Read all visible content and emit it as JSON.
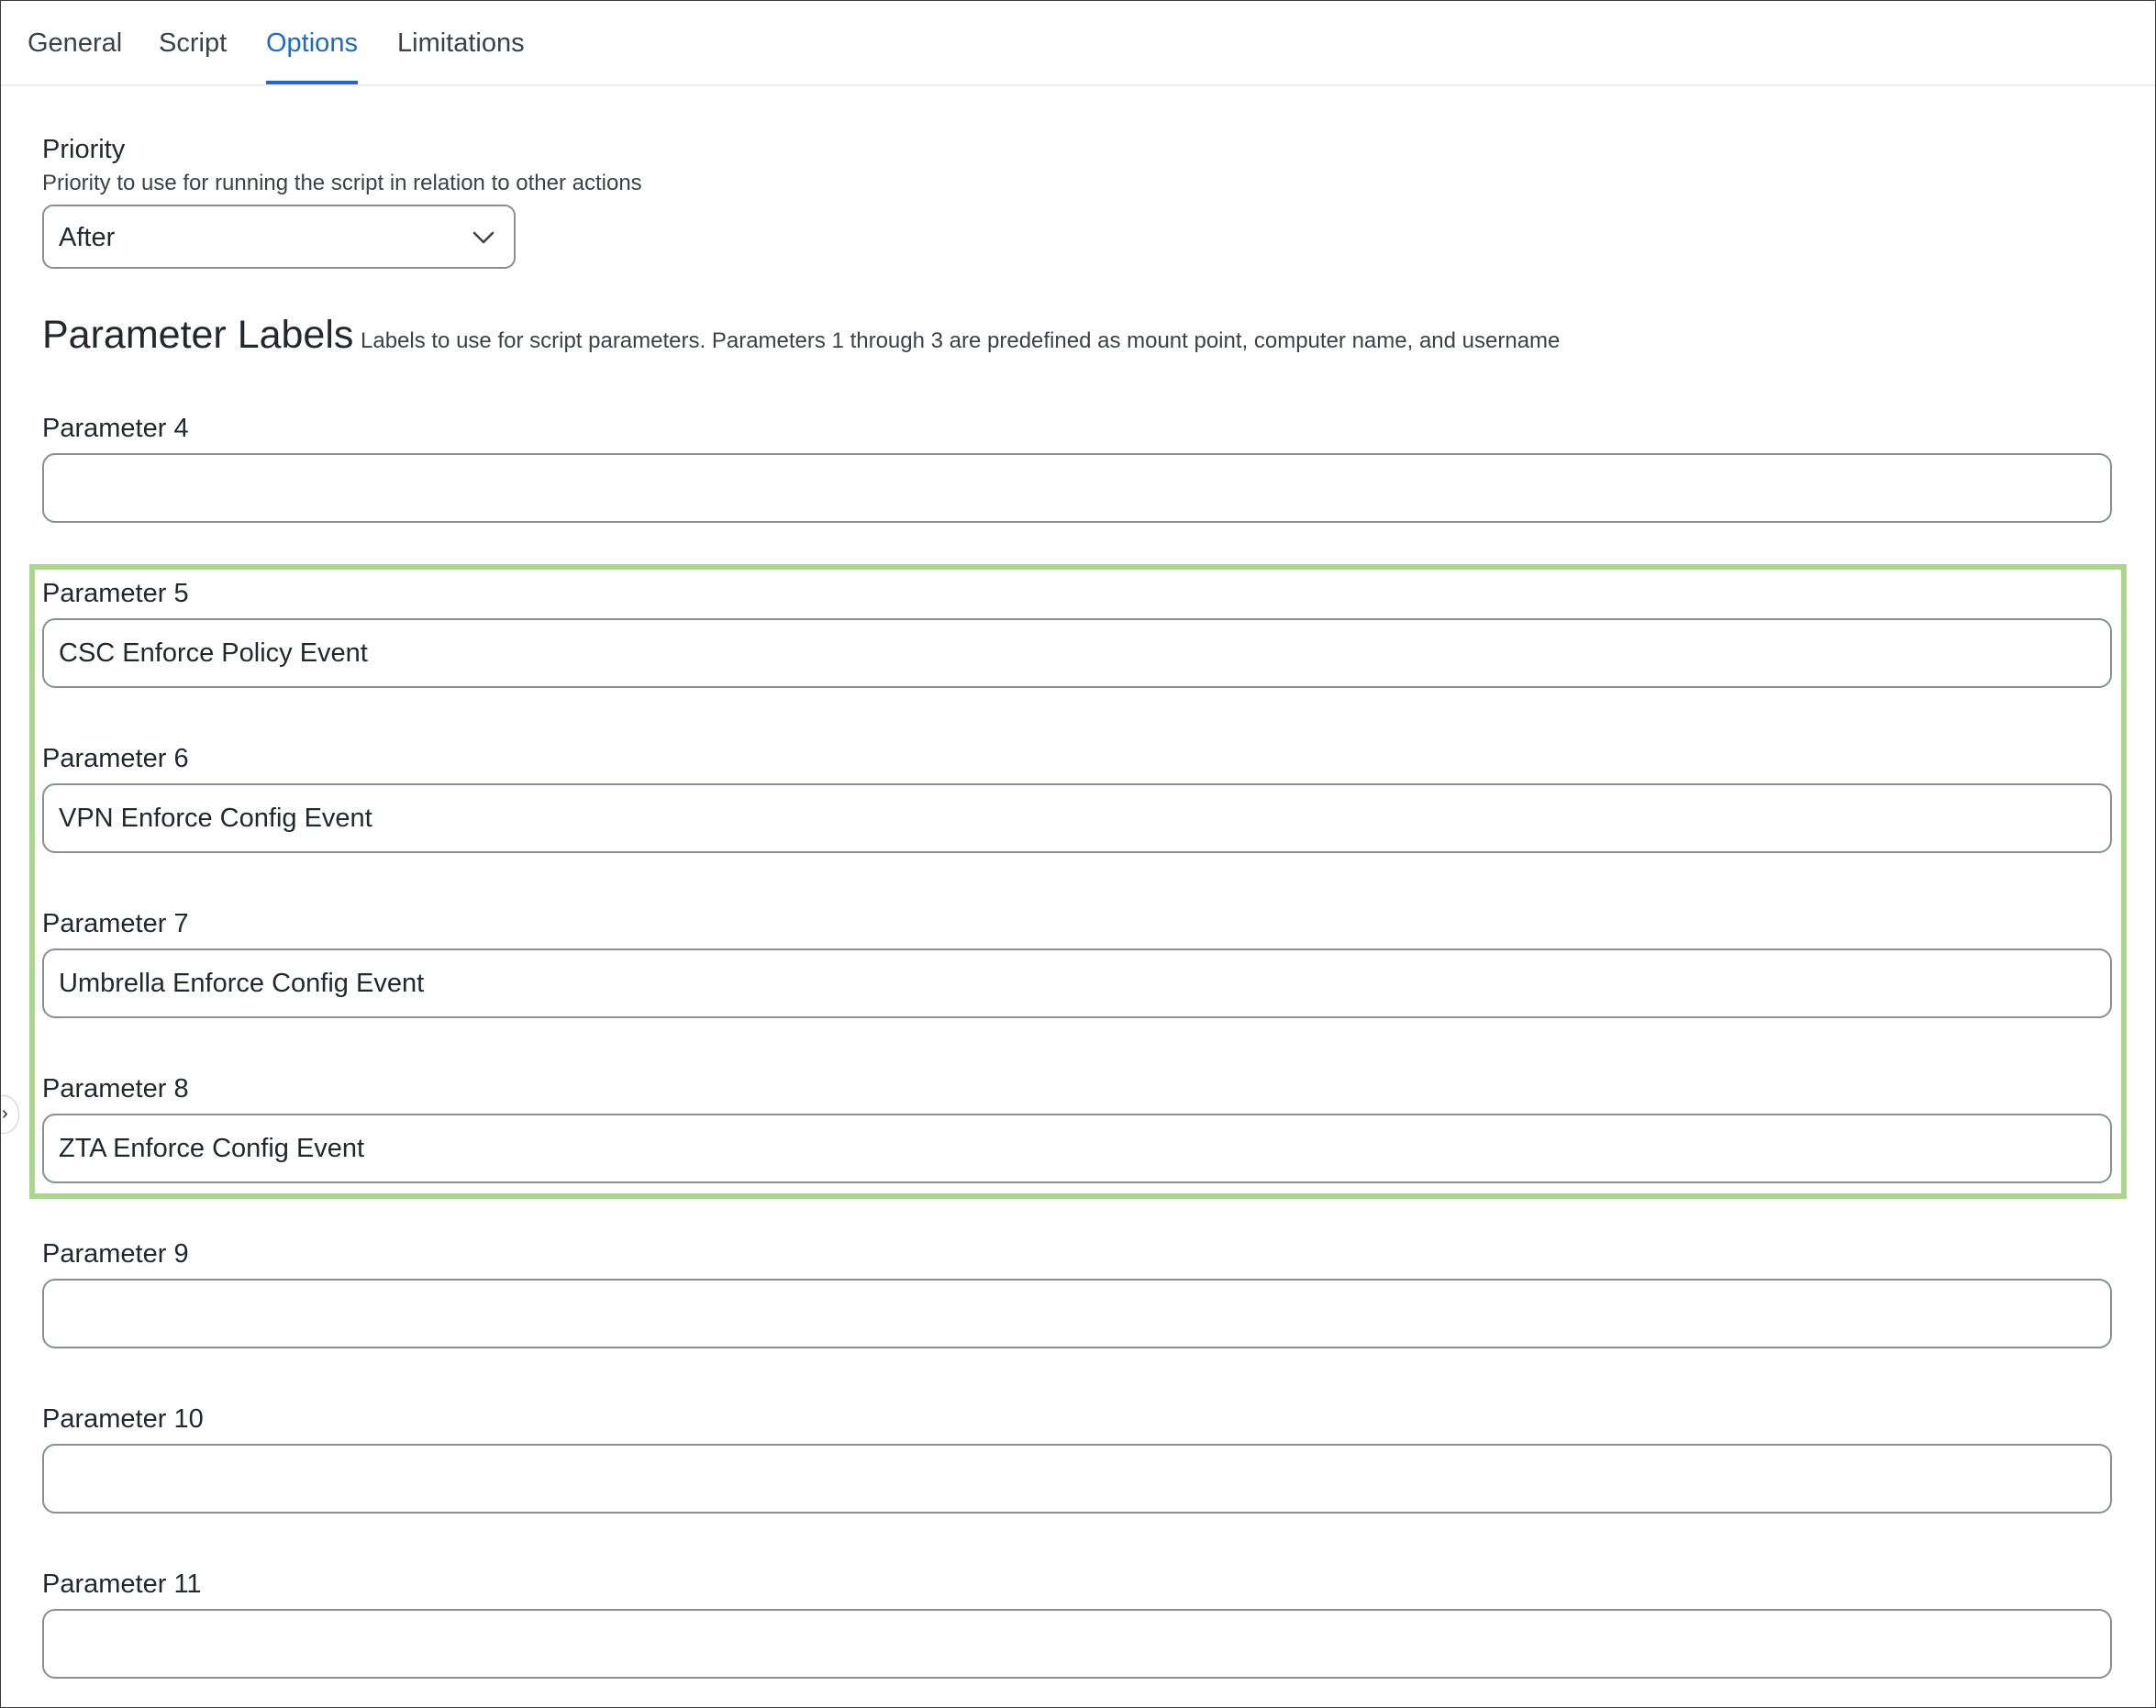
{
  "tabs": [
    {
      "label": "General",
      "active": false
    },
    {
      "label": "Script",
      "active": false
    },
    {
      "label": "Options",
      "active": true
    },
    {
      "label": "Limitations",
      "active": false
    }
  ],
  "priority": {
    "label": "Priority",
    "help": "Priority to use for running the script in relation to other actions",
    "selected": "After",
    "icon": "chevron-down-icon"
  },
  "parameter_labels": {
    "title": "Parameter Labels",
    "description": "Labels to use for script parameters. Parameters 1 through 3 are predefined as mount point, computer name, and username",
    "fields": [
      {
        "label": "Parameter 4",
        "value": ""
      },
      {
        "label": "Parameter 5",
        "value": "CSC Enforce Policy Event"
      },
      {
        "label": "Parameter 6",
        "value": "VPN Enforce Config Event"
      },
      {
        "label": "Parameter 7",
        "value": "Umbrella Enforce Config Event"
      },
      {
        "label": "Parameter 8",
        "value": "ZTA Enforce Config Event"
      },
      {
        "label": "Parameter 9",
        "value": ""
      },
      {
        "label": "Parameter 10",
        "value": ""
      },
      {
        "label": "Parameter 11",
        "value": ""
      }
    ]
  },
  "colors": {
    "accent": "#1d69cc",
    "highlight": "#aad88a"
  }
}
